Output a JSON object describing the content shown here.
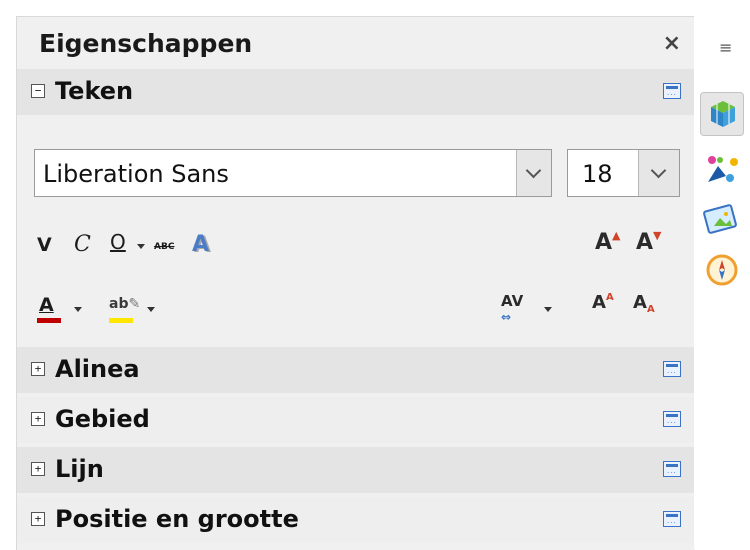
{
  "panel": {
    "title": "Eigenschappen",
    "close_label": "×"
  },
  "sections": [
    {
      "label": "Teken",
      "expanded": true,
      "toggle": "−"
    },
    {
      "label": "Alinea",
      "expanded": false,
      "toggle": "+"
    },
    {
      "label": "Gebied",
      "expanded": false,
      "toggle": "+"
    },
    {
      "label": "Lijn",
      "expanded": false,
      "toggle": "+"
    },
    {
      "label": "Positie en grootte",
      "expanded": false,
      "toggle": "+"
    }
  ],
  "teken": {
    "font_name": "Liberation Sans",
    "font_size": "18",
    "bold_glyph": "V",
    "italic_glyph": "C",
    "underline_glyph": "O",
    "strike_glyph": "ABC",
    "shadow_glyph": "A",
    "grow_glyph": "A",
    "shrink_glyph": "A",
    "spacing_glyph": "AV",
    "super_glyph": "A",
    "sub_glyph": "A",
    "highlight_glyph": "ab",
    "font_color": "#c00000",
    "highlight_color": "#ffe600"
  },
  "sidebar": {
    "menu_glyph": "≡",
    "items": [
      "properties-deck",
      "styles-deck",
      "gallery-deck",
      "navigator-deck"
    ]
  }
}
